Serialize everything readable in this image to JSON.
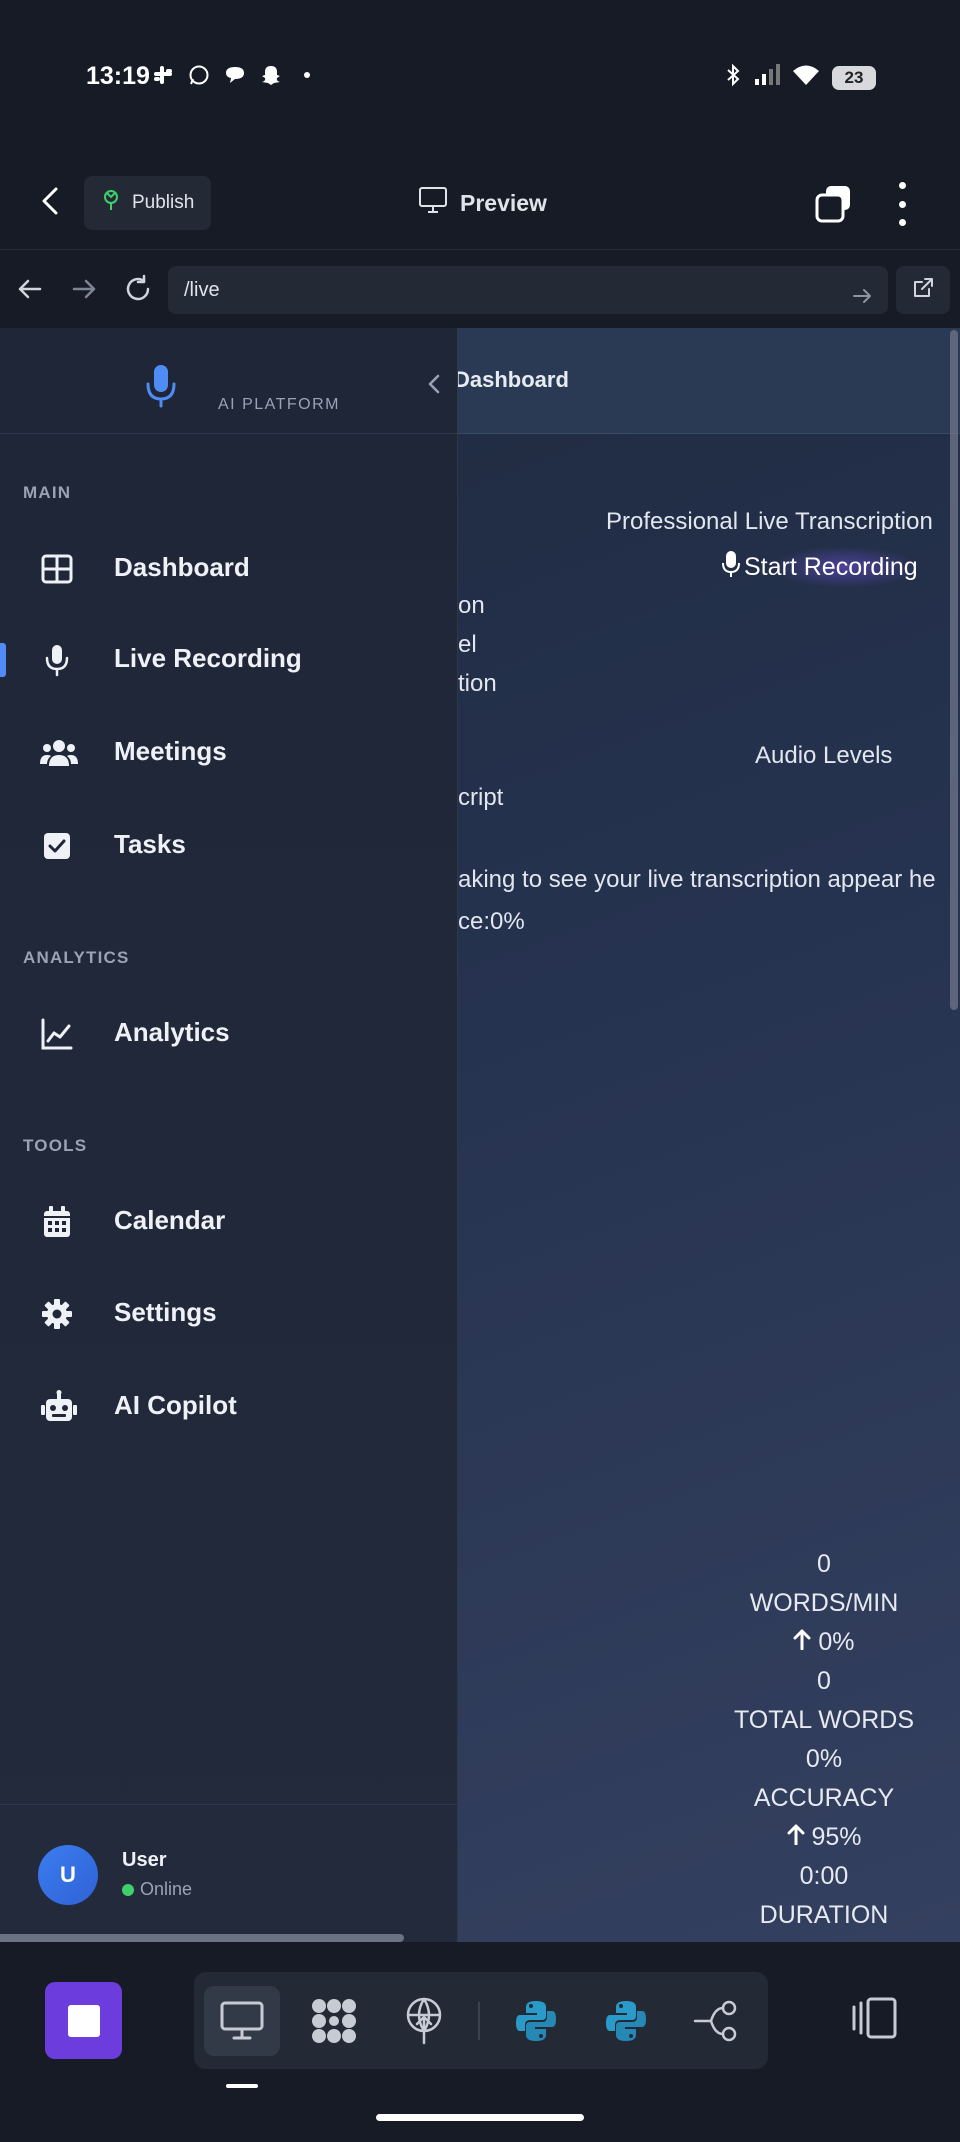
{
  "status_bar": {
    "time": "13:19",
    "battery": "23",
    "app_icons": [
      "slack-icon",
      "whatsapp-icon",
      "chat-icon",
      "snapchat-icon",
      "dot-icon"
    ],
    "system_icons": [
      "bluetooth-icon",
      "signal-icon",
      "wifi-icon",
      "battery-icon"
    ]
  },
  "toolbar": {
    "publish_label": "Publish",
    "preview_label": "Preview"
  },
  "browser": {
    "url": "/live"
  },
  "sidebar": {
    "brand_subtitle": "AI PLATFORM",
    "sections": {
      "main": "MAIN",
      "analytics": "ANALYTICS",
      "tools": "TOOLS"
    },
    "items": [
      {
        "label": "Dashboard",
        "icon": "dashboard-grid-icon"
      },
      {
        "label": "Live Recording",
        "icon": "microphone-icon",
        "active": true
      },
      {
        "label": "Meetings",
        "icon": "users-icon"
      },
      {
        "label": "Tasks",
        "icon": "checkbox-icon"
      },
      {
        "label": "Analytics",
        "icon": "line-chart-icon"
      },
      {
        "label": "Calendar",
        "icon": "calendar-icon"
      },
      {
        "label": "Settings",
        "icon": "gear-icon"
      },
      {
        "label": "AI Copilot",
        "icon": "robot-icon"
      }
    ],
    "user": {
      "initial": "U",
      "name": "User",
      "status": "Online"
    }
  },
  "main": {
    "header_title": "Dashboard",
    "subtitle": "Professional Live Transcription",
    "record_button": "Start Recording",
    "partial_lines": [
      "on",
      "el",
      "tion"
    ],
    "audio_levels": "Audio Levels",
    "transcript_fragment": "cript",
    "placeholder_text": "aking to see your live transcription appear he",
    "confidence_fragment": "ce:0%",
    "stats": {
      "wpm_value": "0",
      "wpm_label": "WORDS/MIN",
      "wpm_change": "0%",
      "total_value": "0",
      "total_label": "TOTAL WORDS",
      "accuracy_value": "0%",
      "accuracy_label": "ACCURACY",
      "accuracy_change": "95%",
      "duration_value": "0:00",
      "duration_label": "DURATION"
    }
  },
  "colors": {
    "accent": "#4f8cf5",
    "stop_button": "#6c3cdc",
    "online": "#3fcf6b",
    "background": "#161b26"
  }
}
